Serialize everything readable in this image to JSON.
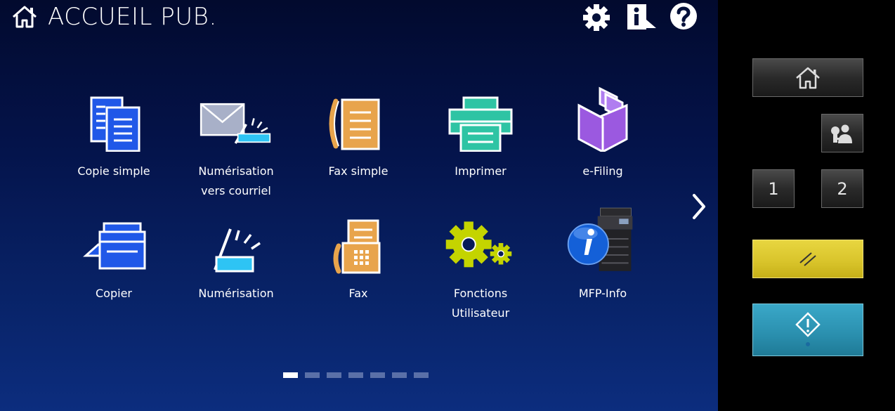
{
  "header": {
    "title": "ACCUEIL PUB.",
    "home_icon": "home-icon",
    "settings_icon": "gear-icon",
    "info_icon": "info-icon",
    "help_icon": "help-icon"
  },
  "tiles": [
    {
      "label": "Copie simple",
      "icon": "easy-copy-icon"
    },
    {
      "label": "Numérisation\nvers courriel",
      "icon": "scan-to-email-icon"
    },
    {
      "label": "Fax simple",
      "icon": "easy-fax-icon"
    },
    {
      "label": "Imprimer",
      "icon": "printer-icon"
    },
    {
      "label": "e-Filing",
      "icon": "e-filing-icon"
    },
    {
      "label": "Copier",
      "icon": "copy-icon"
    },
    {
      "label": "Numérisation",
      "icon": "scan-icon"
    },
    {
      "label": "Fax",
      "icon": "fax-icon"
    },
    {
      "label": "Fonctions\nUtilisateur",
      "icon": "user-functions-icon"
    },
    {
      "label": "MFP-Info",
      "icon": "mfp-info-icon"
    }
  ],
  "pagination": {
    "pages": 7,
    "current": 1
  },
  "side_panel": {
    "home_icon": "home-icon",
    "user_icon": "user-access-icon",
    "num1": "1",
    "num2": "2",
    "reset_icon": "reset-icon",
    "start_icon": "start-icon"
  },
  "colors": {
    "blue_icon": "#2058e8",
    "orange_icon": "#e8a44c",
    "teal_icon": "#2ec4a4",
    "purple_icon": "#9b59e0",
    "yellow_green_icon": "#c4d400",
    "cyan_icon": "#2ec4f4",
    "reset_button": "#d8c32a",
    "start_button": "#2a8fae"
  }
}
